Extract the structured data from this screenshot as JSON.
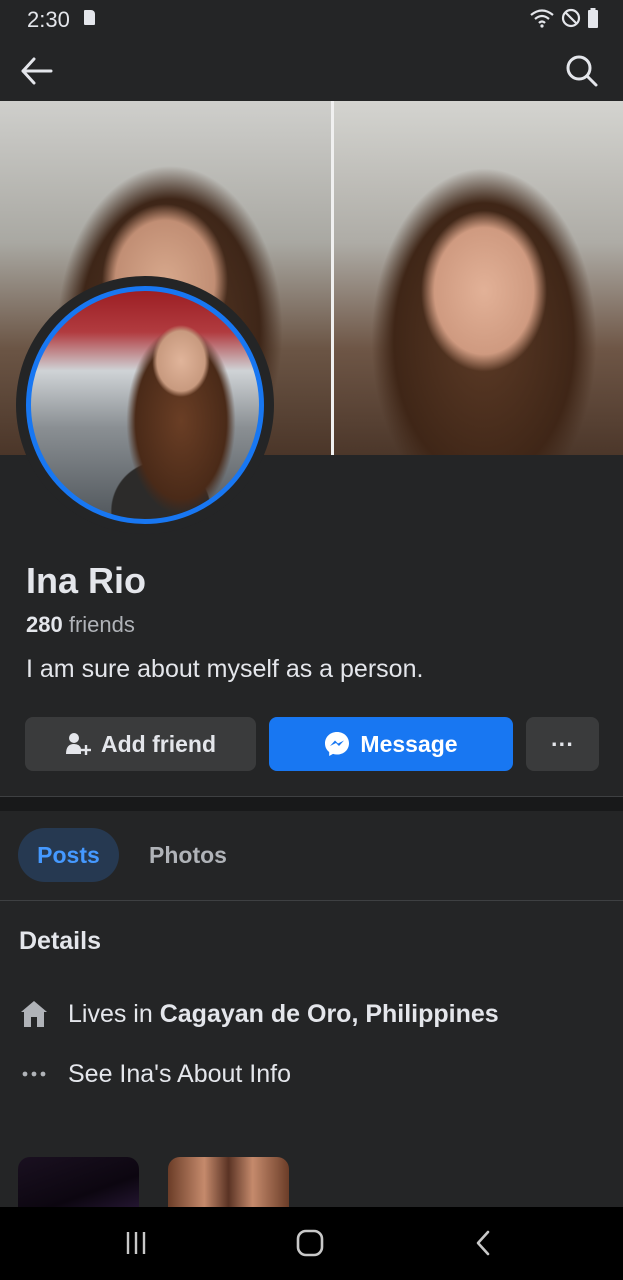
{
  "status_bar": {
    "time": "2:30",
    "icons": [
      "sd-card-icon",
      "wifi-icon",
      "do-not-disturb-icon",
      "battery-icon"
    ]
  },
  "top_bar": {
    "back_icon": "arrow-left-icon",
    "search_icon": "search-icon"
  },
  "profile": {
    "name": "Ina Rio",
    "friends_count": "280",
    "friends_label": " friends",
    "bio": "I am sure about myself as a person."
  },
  "actions": {
    "add_friend_label": "Add friend",
    "message_label": "Message",
    "more_label": "···"
  },
  "tabs": [
    {
      "label": "Posts",
      "selected": true
    },
    {
      "label": "Photos",
      "selected": false
    }
  ],
  "details": {
    "title": "Details",
    "lives_in_prefix": "Lives in ",
    "lives_in_place": "Cagayan de Oro, Philippines",
    "about_link": "See Ina's About Info"
  },
  "nav_bar": {
    "icons": [
      "recent-apps-icon",
      "home-icon",
      "back-nav-icon"
    ]
  },
  "colors": {
    "background": "#242526",
    "accent": "#1877f2",
    "button_secondary": "#3a3b3c",
    "tab_selected_bg": "#263951",
    "tab_selected_text": "#4599ff"
  }
}
